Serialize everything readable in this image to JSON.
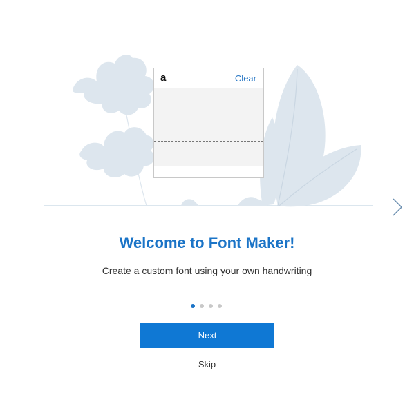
{
  "illustration": {
    "card_letter": "a",
    "card_clear": "Clear",
    "leaf_color": "#dde6ee",
    "ground_color": "#cfdde8"
  },
  "carousel": {
    "next_arrow_icon": "chevron-right-icon",
    "active_page": 1,
    "page_count": 4
  },
  "content": {
    "title": "Welcome to Font Maker!",
    "subtitle": "Create a custom font using your own handwriting"
  },
  "actions": {
    "next_label": "Next",
    "skip_label": "Skip"
  },
  "colors": {
    "accent": "#0f78d4",
    "title": "#1b74c7"
  }
}
